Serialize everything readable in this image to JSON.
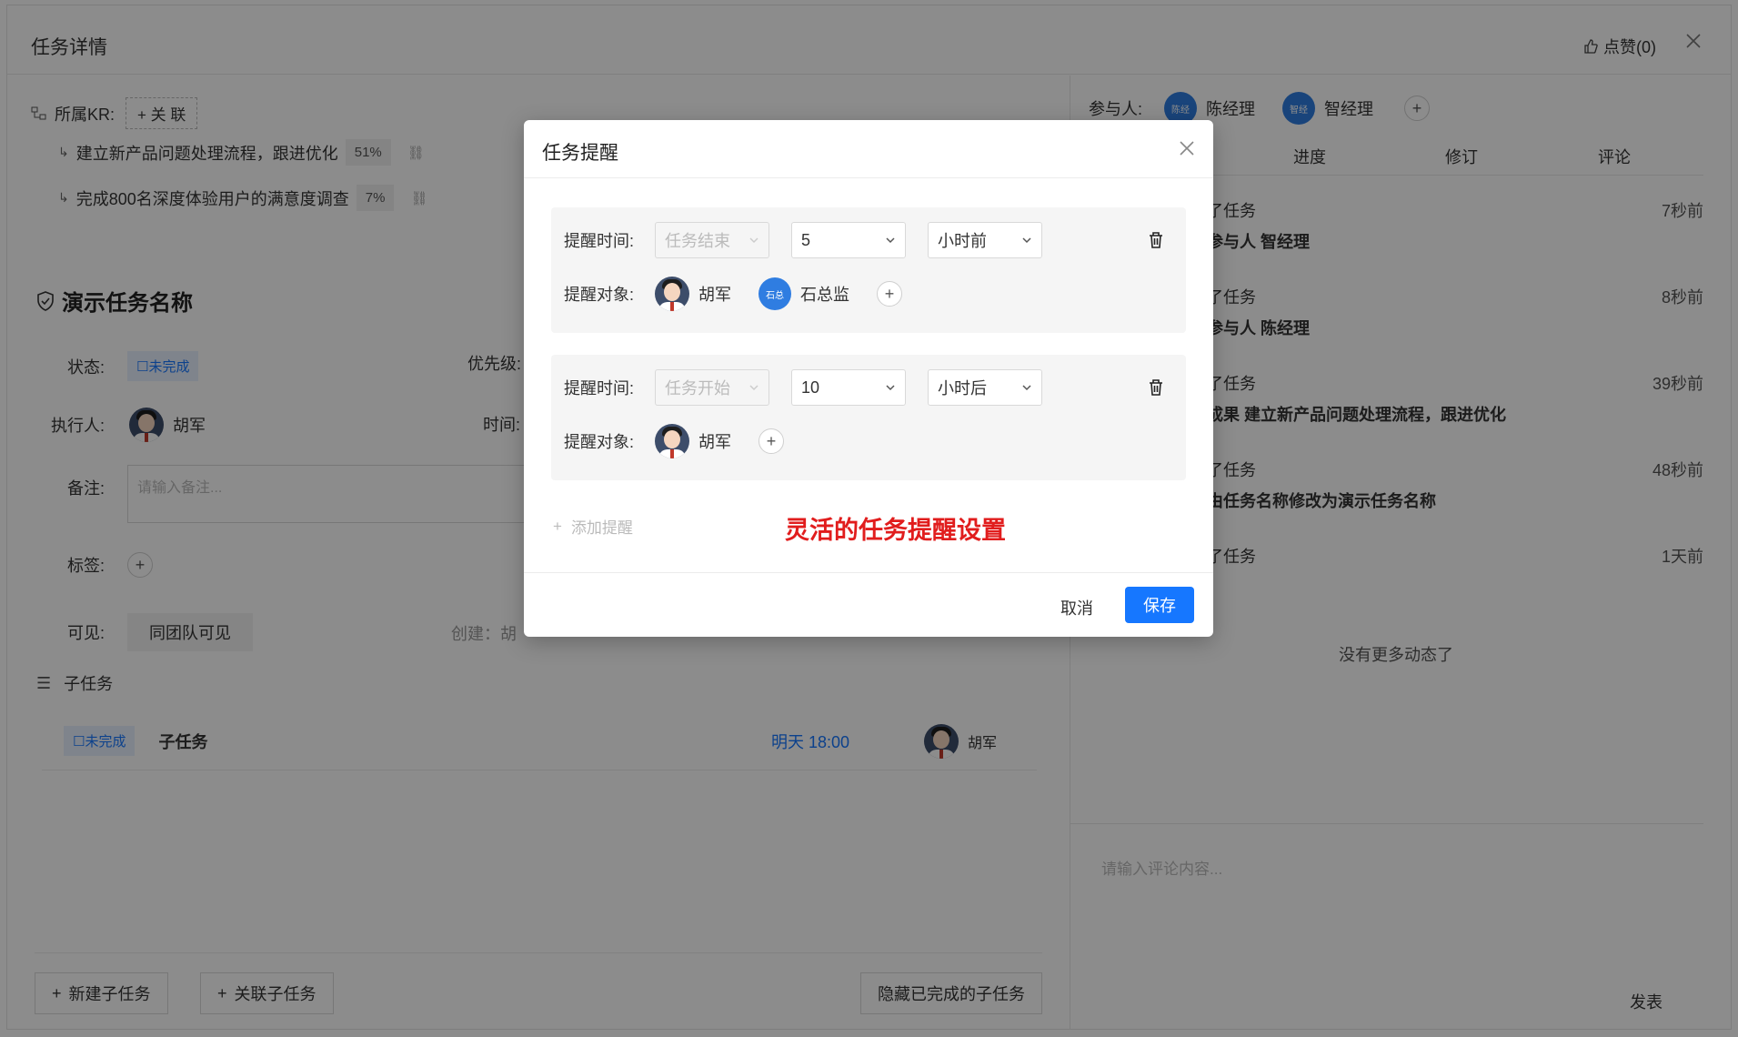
{
  "header": {
    "title": "任务详情",
    "like_label": "点赞(0)"
  },
  "kr": {
    "label": "所属KR:",
    "link_button": "+ 关 联",
    "items": [
      {
        "text": "建立新产品问题处理流程，跟进优化",
        "percent": "51%"
      },
      {
        "text": "完成800名深度体验用户的满意度调查",
        "percent": "7%"
      }
    ]
  },
  "task": {
    "name": "演示任务名称",
    "status_label": "状态:",
    "status_value": "☐未完成",
    "priority_label": "优先级:",
    "executor_label": "执行人:",
    "executor_name": "胡军",
    "time_label": "时间:",
    "notes_label": "备注:",
    "notes_placeholder": "请输入备注...",
    "tags_label": "标签:",
    "visibility_label": "可见:",
    "visibility_value": "同团队可见",
    "created_label": "创建：胡"
  },
  "subtasks": {
    "section_label": "子任务",
    "items": [
      {
        "status": "☐未完成",
        "name": "子任务",
        "due": "明天 18:00",
        "assignee": "胡军"
      }
    ],
    "new_button": "新建子任务",
    "link_button": "关联子任务",
    "hide_done_button": "隐藏已完成的子任务"
  },
  "right_panel": {
    "participants_label": "参与人:",
    "participants": [
      {
        "initials": "陈经",
        "name": "陈经理"
      },
      {
        "initials": "智经",
        "name": "智经理"
      }
    ],
    "tabs": [
      "进度",
      "修订",
      "评论"
    ],
    "activities": [
      {
        "line1": "了任务",
        "line2": "参与人 智经理",
        "time": "7秒前"
      },
      {
        "line1": "了任务",
        "line2": "参与人 陈经理",
        "time": "8秒前"
      },
      {
        "line1": "了任务",
        "line2": "成果 建立新产品问题处理流程，跟进优化",
        "time": "39秒前"
      },
      {
        "line1": "了任务",
        "line2": "由任务名称修改为演示任务名称",
        "time": "48秒前"
      },
      {
        "line1": "了任务",
        "line2": "",
        "time": "1天前"
      }
    ],
    "no_more": "没有更多动态了",
    "comment_placeholder": "请输入评论内容...",
    "publish_label": "发表"
  },
  "modal": {
    "title": "任务提醒",
    "reminders": [
      {
        "time_label": "提醒时间:",
        "anchor": "任务结束",
        "amount": "5",
        "unit": "小时前",
        "target_label": "提醒对象:",
        "targets": [
          {
            "type": "photo",
            "name": "胡军"
          },
          {
            "type": "initials",
            "initials": "石总",
            "name": "石总监"
          }
        ]
      },
      {
        "time_label": "提醒时间:",
        "anchor": "任务开始",
        "amount": "10",
        "unit": "小时后",
        "target_label": "提醒对象:",
        "targets": [
          {
            "type": "photo",
            "name": "胡军"
          }
        ]
      }
    ],
    "add_reminder": "添加提醒",
    "highlight": "灵活的任务提醒设置",
    "cancel_label": "取消",
    "save_label": "保存"
  },
  "colors": {
    "primary": "#1677ff",
    "highlight": "#e11d1d",
    "overlay": "rgba(0,0,0,0.45)"
  }
}
